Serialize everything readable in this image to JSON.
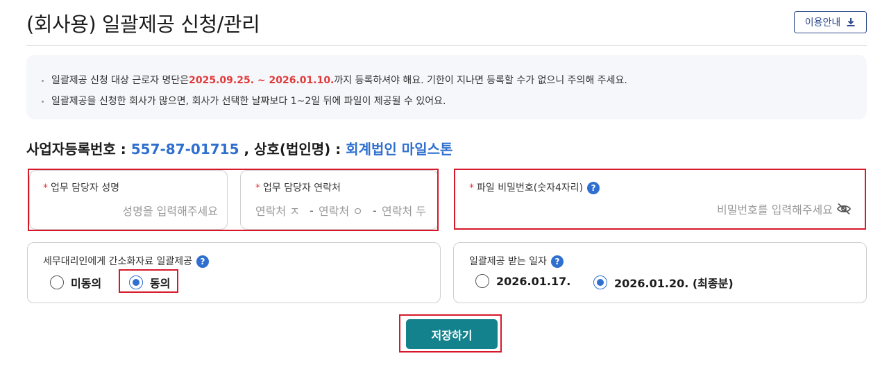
{
  "page": {
    "title": "(회사용) 일괄제공 신청/관리",
    "guide_button": "이용안내"
  },
  "notice": {
    "line1_before": "일괄제공 신청 대상 근로자 명단은 ",
    "line1_period": "2025.09.25. ~ 2026.01.10.",
    "line1_after": " 까지 등록하셔야 해요. 기한이 지나면 등록할 수가 없으니 주의해 주세요.",
    "line2": "일괄제공을 신청한 회사가 많으면, 회사가 선택한 날짜보다 1~2일 뒤에 파일이 제공될 수 있어요."
  },
  "business": {
    "reg_label": "사업자등록번호 : ",
    "reg_number": "557-87-01715",
    "name_label": " , 상호(법인명) : ",
    "company_name": "회계법인 마일스톤"
  },
  "fields": {
    "manager_name": {
      "required_mark": "*",
      "label": "업무 담당자 성명",
      "placeholder": "성명을 입력해주세요",
      "value": ""
    },
    "manager_contact": {
      "required_mark": "*",
      "label": "업무 담당자 연락처",
      "part1_placeholder": "연락처 ㅈ",
      "part2_placeholder": "연락처 ㅇ",
      "part3_placeholder": "연락처 두",
      "separator": "-"
    },
    "file_password": {
      "required_mark": "*",
      "label": "파일 비밀번호(숫자4자리)",
      "placeholder": "비밀번호를 입력해주세요",
      "value": ""
    }
  },
  "consent": {
    "label": "세무대리인에게 간소화자료 일괄제공",
    "help_icon": "?",
    "options": [
      {
        "label": "미동의",
        "checked": false
      },
      {
        "label": "동의",
        "checked": true
      }
    ]
  },
  "receive_date": {
    "label": "일괄제공 받는 일자",
    "help_icon": "?",
    "options": [
      {
        "label": "2026.01.17.",
        "checked": false
      },
      {
        "label": "2026.01.20. (최종분)",
        "checked": true
      }
    ]
  },
  "save_button": "저장하기",
  "icons": {
    "download": "download-icon",
    "help": "help-icon",
    "password_visibility": "eye-off-icon"
  },
  "colors": {
    "accent_blue": "#2f6fcf",
    "required_red": "#e03a3a",
    "save_teal": "#13828d",
    "highlight_red": "#d6182a"
  }
}
